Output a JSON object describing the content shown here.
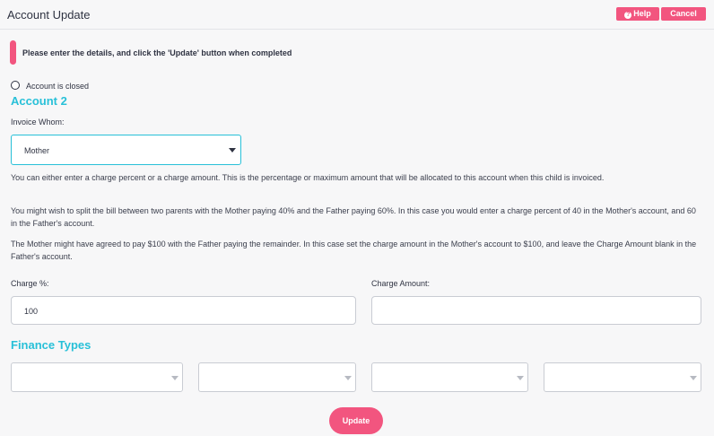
{
  "header": {
    "title": "Account Update",
    "help_label": "Help",
    "help_icon": "question-circle-icon",
    "cancel_label": "Cancel",
    "accent_color": "#f2557f"
  },
  "notice": {
    "text": "Please enter the details, and click the 'Update' button when completed"
  },
  "account": {
    "closed_label": "Account is closed",
    "closed_checked": false,
    "title": "Account 2",
    "title_color": "#28c0d8"
  },
  "invoice_whom": {
    "label": "Invoice Whom:",
    "selected": "Mother"
  },
  "help_text": [
    "You can either enter a charge percent or a charge amount. This is the percentage or maximum amount that will be allocated to this account when this child is invoiced.",
    "You might wish to split the bill between two parents with the Mother paying 40% and the Father paying 60%. In this case you would enter a charge percent of 40 in the Mother's account, and 60 in the Father's account.",
    "The Mother might have agreed to pay $100 with the Father paying the remainder. In this case set the charge amount in the Mother's account to $100, and leave the Charge Amount blank in the Father's account."
  ],
  "charge_percent": {
    "label": "Charge %:",
    "value": "100"
  },
  "charge_amount": {
    "label": "Charge Amount:",
    "value": ""
  },
  "finance_types": {
    "title": "Finance Types",
    "selects": [
      "",
      "",
      "",
      ""
    ]
  },
  "footer": {
    "update_label": "Update"
  }
}
